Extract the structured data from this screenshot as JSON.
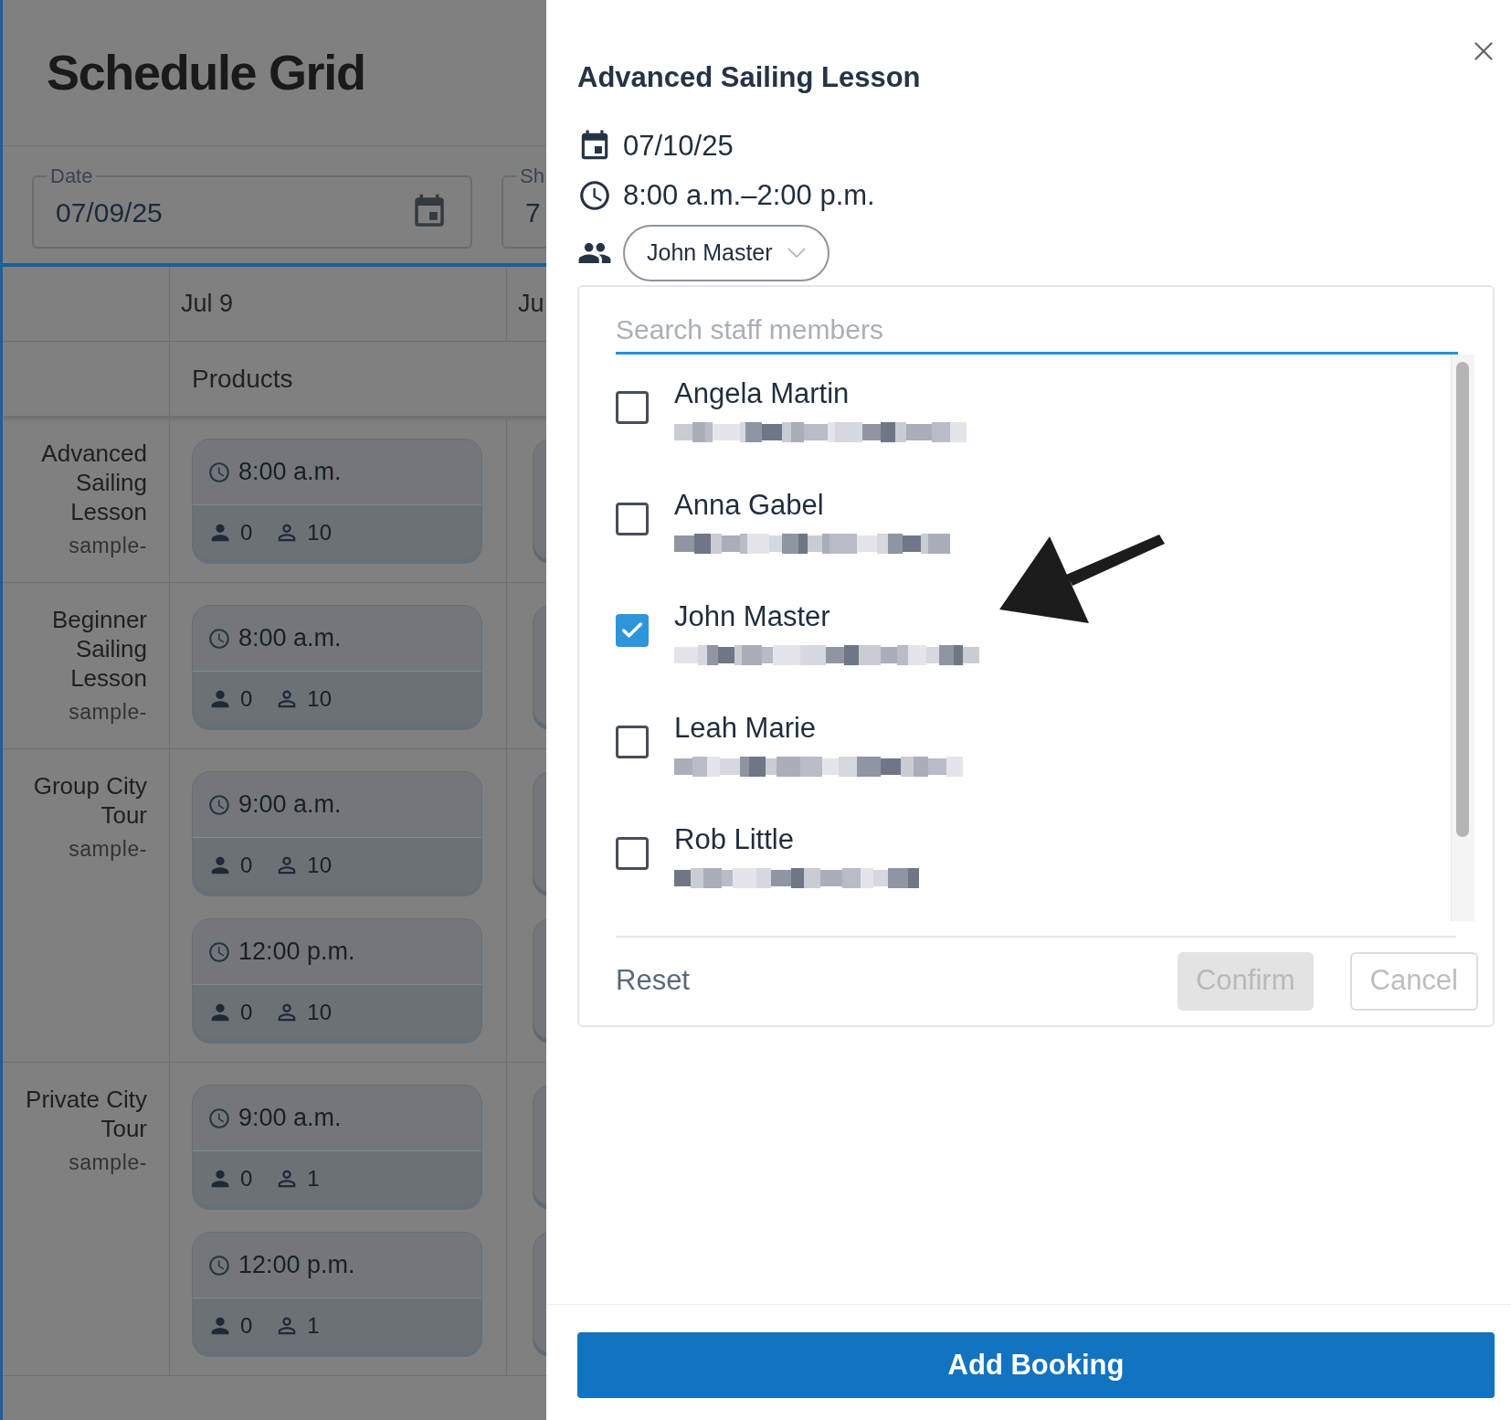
{
  "page": {
    "title": "Schedule Grid",
    "filters": [
      {
        "kind": "date",
        "label": "Date",
        "value": "07/09/25"
      },
      {
        "kind": "cut",
        "label": "Sh",
        "value": "7"
      }
    ]
  },
  "grid": {
    "columns": [
      "Jul 9",
      "Ju"
    ],
    "subheader": "Products",
    "rows": [
      {
        "name": "Advanced Sailing Lesson",
        "code": "sample-",
        "slots": [
          {
            "time": "8:00 a.m.",
            "booked": "0",
            "capacity": "10"
          }
        ]
      },
      {
        "name": "Beginner Sailing Lesson",
        "code": "sample-",
        "slots": [
          {
            "time": "8:00 a.m.",
            "booked": "0",
            "capacity": "10"
          }
        ]
      },
      {
        "name": "Group City Tour",
        "code": "sample-",
        "slots": [
          {
            "time": "9:00 a.m.",
            "booked": "0",
            "capacity": "10"
          },
          {
            "time": "12:00 p.m.",
            "booked": "0",
            "capacity": "10"
          }
        ]
      },
      {
        "name": "Private City Tour",
        "code": "sample-",
        "slots": [
          {
            "time": "9:00 a.m.",
            "booked": "0",
            "capacity": "1"
          },
          {
            "time": "12:00 p.m.",
            "booked": "0",
            "capacity": "1"
          }
        ]
      }
    ]
  },
  "dialog": {
    "title": "Advanced Sailing Lesson",
    "date": "07/10/25",
    "time": "8:00 a.m.–2:00 p.m.",
    "staff_select": {
      "value": "John Master",
      "expanded": true
    },
    "staff_dropdown": {
      "search_placeholder": "Search staff members",
      "members": [
        {
          "name": "Angela Martin",
          "checked": false
        },
        {
          "name": "Anna Gabel",
          "checked": false
        },
        {
          "name": "John Master",
          "checked": true
        },
        {
          "name": "Leah Marie",
          "checked": false
        },
        {
          "name": "Rob Little",
          "checked": false
        }
      ],
      "reset": "Reset",
      "confirm": {
        "label": "Confirm",
        "disabled": true
      },
      "cancel": "Cancel"
    },
    "primary_button": "Add Booking"
  }
}
